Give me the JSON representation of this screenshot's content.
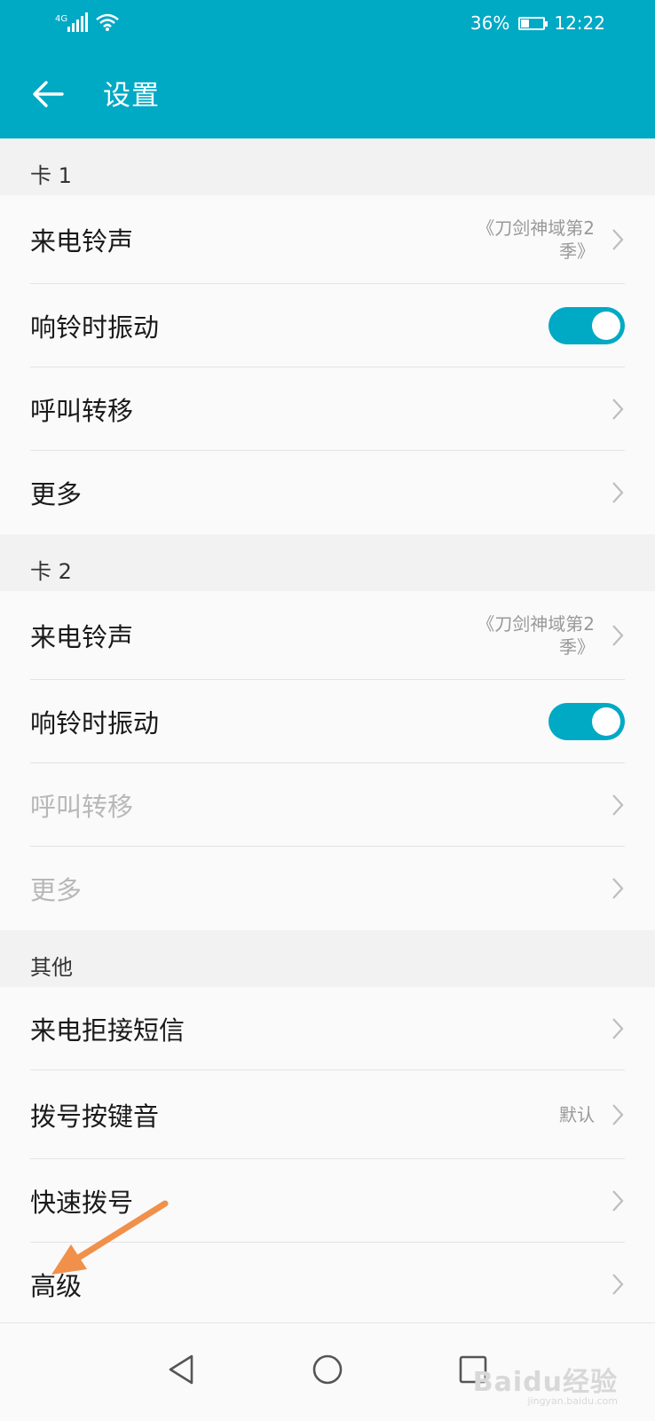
{
  "status_bar": {
    "network": "4G",
    "battery_text": "36%",
    "battery_level": 0.36,
    "time": "12:22"
  },
  "appbar": {
    "title": "设置"
  },
  "sections": {
    "card1": {
      "header": "卡 1",
      "ringtone": {
        "label": "来电铃声",
        "value_line1": "《刀剑神域第2",
        "value_line2": "季》"
      },
      "vibrate": {
        "label": "响铃时振动",
        "checked": true
      },
      "forward": {
        "label": "呼叫转移"
      },
      "more": {
        "label": "更多"
      }
    },
    "card2": {
      "header": "卡 2",
      "ringtone": {
        "label": "来电铃声",
        "value_line1": "《刀剑神域第2",
        "value_line2": "季》"
      },
      "vibrate": {
        "label": "响铃时振动",
        "checked": true
      },
      "forward": {
        "label": "呼叫转移",
        "disabled": true
      },
      "more": {
        "label": "更多",
        "disabled": true
      }
    },
    "other": {
      "header": "其他",
      "reject_sms": {
        "label": "来电拒接短信"
      },
      "dial_tone": {
        "label": "拨号按键音",
        "value": "默认"
      },
      "speed_dial": {
        "label": "快速拨号"
      },
      "advanced": {
        "label": "高级"
      }
    }
  },
  "watermark": {
    "brand": "Baidu经验",
    "url": "jingyan.baidu.com"
  },
  "colors": {
    "accent": "#00a9c4",
    "annotation_arrow": "#f0904a"
  },
  "icons": [
    "back-arrow-icon",
    "chevron-right-icon",
    "nav-back-icon",
    "nav-home-icon",
    "nav-recents-icon",
    "signal-icon",
    "wifi-icon",
    "battery-icon"
  ]
}
